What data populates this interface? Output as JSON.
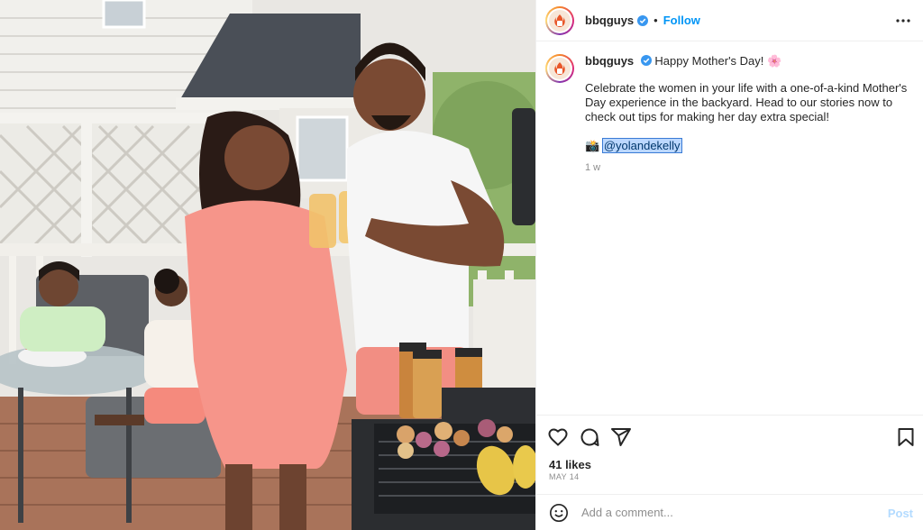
{
  "post": {
    "username": "bbqguys",
    "follow_label": "Follow",
    "dot": "•",
    "caption_title": "Happy Mother's Day! 🌸",
    "caption_text": "Celebrate the women in your life with a one-of-a-kind Mother's Day experience in the backyard. Head to our stories now to check out tips for making her day extra special!",
    "photo_credit_icon": "📸",
    "mention": "@yolandekelly",
    "time_ago": "1 w",
    "likes": "41 likes",
    "date": "MAY 14"
  },
  "comment": {
    "placeholder": "Add a comment...",
    "post_label": "Post"
  },
  "colors": {
    "accent": "#0095f6",
    "verified": "#3897f0",
    "post_disabled": "#b3dbff",
    "mention_highlight": "#bcd8ff"
  },
  "icons": {
    "header_more": "more-icon",
    "like": "heart-icon",
    "comment": "comment-icon",
    "share": "share-icon",
    "save": "bookmark-icon",
    "emoji": "emoji-icon"
  }
}
